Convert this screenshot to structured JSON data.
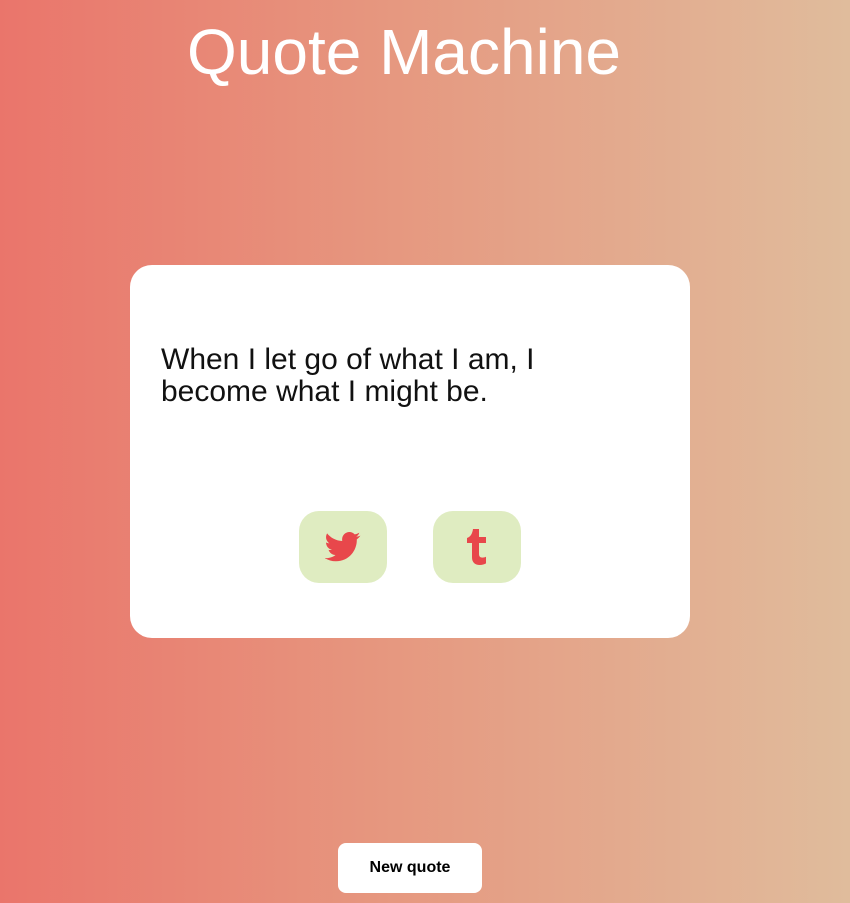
{
  "header": {
    "title": "Quote Machine"
  },
  "quote": {
    "text": "When I let go of what I am, I become what I might be."
  },
  "share": {
    "twitter_icon": "twitter-bird-icon",
    "tumblr_icon": "tumblr-t-icon",
    "button_bg": "#dfecc1",
    "icon_color": "#e8474b"
  },
  "controls": {
    "new_quote_label": "New quote"
  },
  "colors": {
    "background_left": "#ea756b",
    "background_right": "#e0bc9c",
    "card": "#ffffff"
  }
}
